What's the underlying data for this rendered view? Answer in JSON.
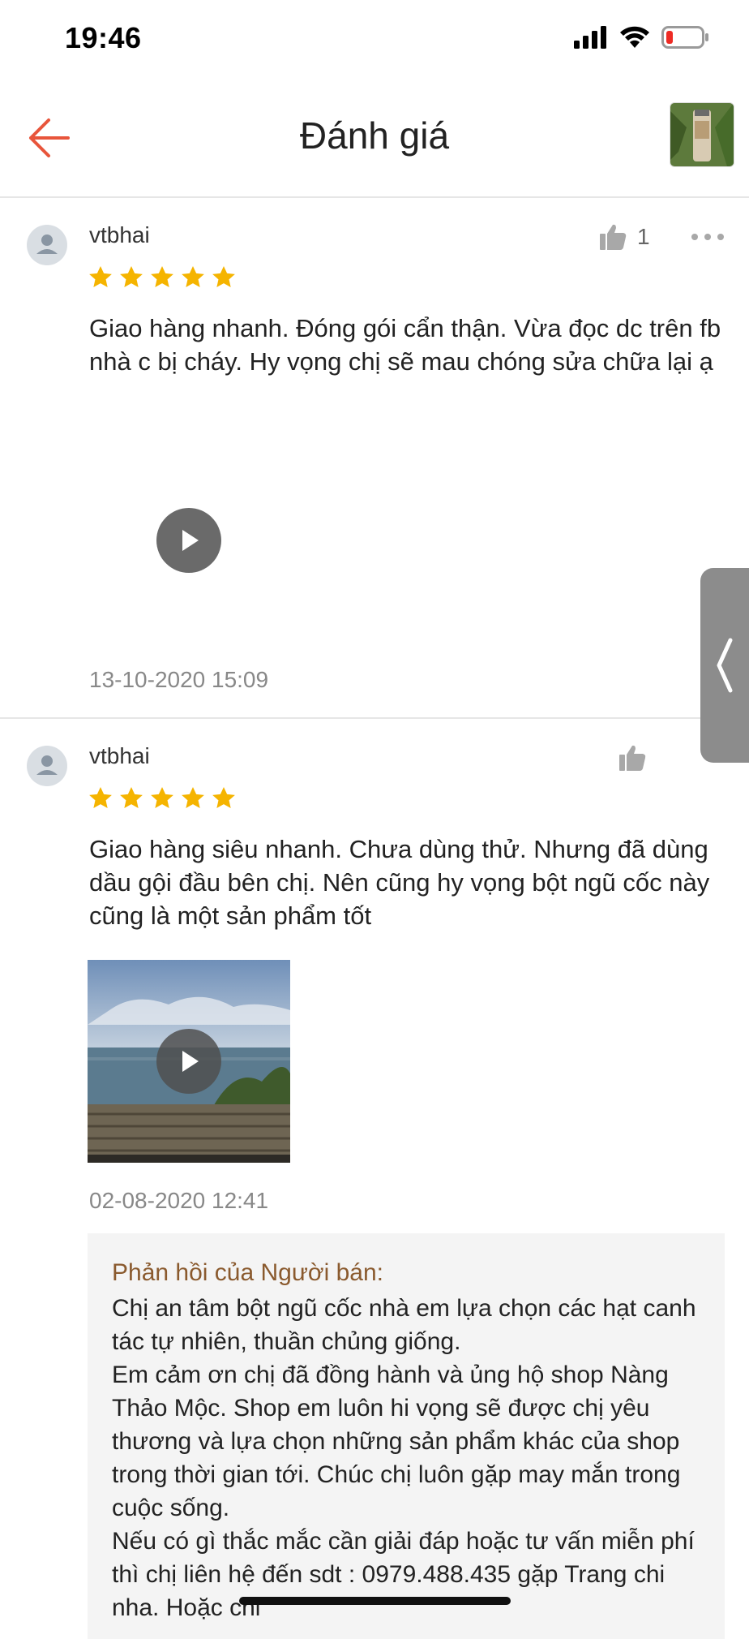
{
  "status_bar": {
    "time": "19:46",
    "icons": [
      "signal-icon",
      "wifi-icon",
      "battery-low-icon"
    ]
  },
  "header": {
    "title": "Đánh giá",
    "back_icon": "arrow-left-icon",
    "accent_color": "#e8553b"
  },
  "reviews": [
    {
      "username": "vtbhai",
      "rating": 5,
      "likes": "1",
      "text": "Giao hàng nhanh. Đóng gói cẩn thận. Vừa đọc dc trên fb nhà c bị cháy. Hy vọng chị sẽ mau chóng sửa chữa lại ạ",
      "has_video": true,
      "date": "13-10-2020 15:09"
    },
    {
      "username": "vtbhai",
      "rating": 5,
      "likes": "",
      "text": "Giao hàng siêu nhanh. Chưa dùng thử. Nhưng đã dùng dầu gội đầu bên chị. Nên cũng hy vọng bột ngũ cốc này cũng là một sản phẩm tốt",
      "has_video": true,
      "date": "02-08-2020 12:41",
      "seller_reply": {
        "title": "Phản hồi của Người bán:",
        "lines": [
          "Chị an tâm bột ngũ cốc nhà em lựa chọn các hạt canh tác tự nhiên, thuần chủng giống.",
          "Em cảm ơn chị đã đồng hành và ủng hộ shop Nàng Thảo Mộc. Shop em luôn hi vọng sẽ được chị yêu thương và lựa chọn những sản phẩm khác của shop trong thời gian tới. Chúc chị luôn gặp may mắn trong cuộc sống.",
          "Nếu có gì thắc mắc cần giải đáp hoặc tư vấn miễn phí thì chị liên hệ đến sdt : 0979.488.435 gặp Trang chi nha. Hoặc chi"
        ]
      }
    }
  ],
  "colors": {
    "star": "#f5b400",
    "date": "#888888",
    "reply_title": "#8a5a2e",
    "reply_bg": "#f4f4f4"
  }
}
